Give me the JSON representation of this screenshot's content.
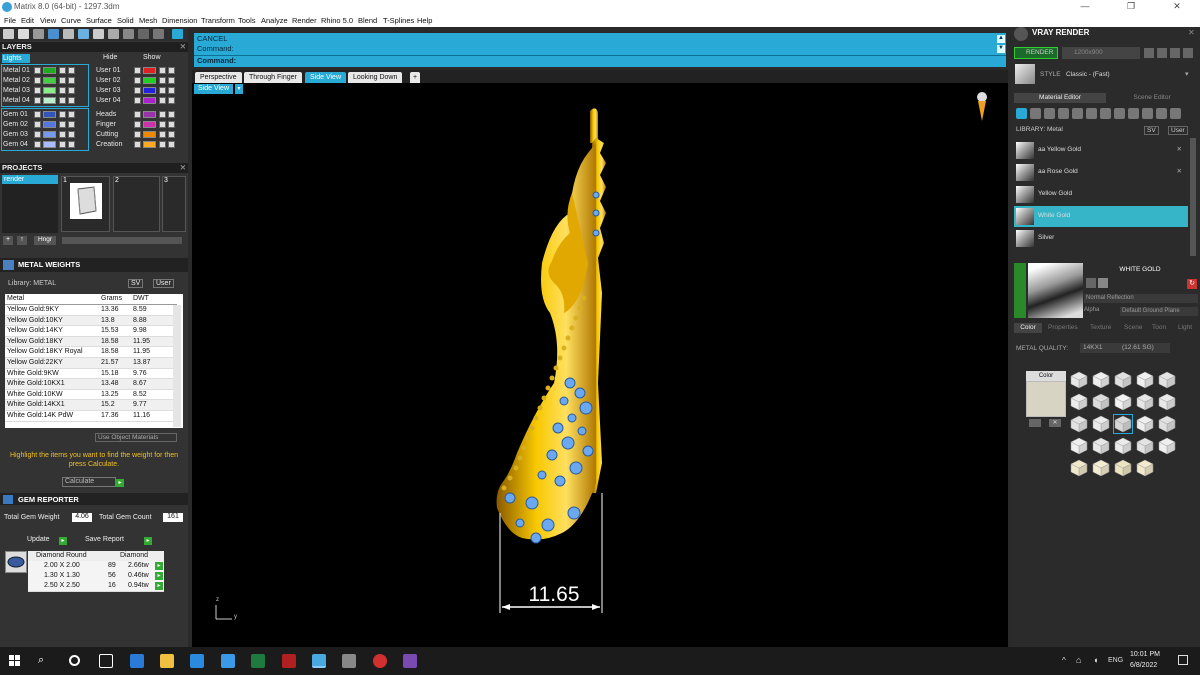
{
  "window": {
    "title": "Matrix 8.0 (64-bit) - 1297.3dm",
    "min": "—",
    "max": "❐",
    "close": "✕"
  },
  "menu": [
    "File",
    "Edit",
    "View",
    "Curve",
    "Surface",
    "Solid",
    "Mesh",
    "Dimension",
    "Transform",
    "Tools",
    "Analyze",
    "Render",
    "Rhino 5.0",
    "Blend",
    "T-Splines",
    "Help"
  ],
  "layers": {
    "title": "LAYERS",
    "lights": "Lights",
    "hide": "Hide",
    "show": "Show",
    "left": [
      {
        "name": "Metal 01",
        "color": "#22aa22"
      },
      {
        "name": "Metal 02",
        "color": "#44cc44"
      },
      {
        "name": "Metal 03",
        "color": "#88ee88"
      },
      {
        "name": "Metal 04",
        "color": "#bbeecc"
      },
      {
        "name": "Gem 01",
        "color": "#3355bb"
      },
      {
        "name": "Gem 02",
        "color": "#5577dd"
      },
      {
        "name": "Gem 03",
        "color": "#7799ee"
      },
      {
        "name": "Gem 04",
        "color": "#aabbff"
      }
    ],
    "right": [
      {
        "name": "User 01",
        "color": "#dd2222"
      },
      {
        "name": "User 02",
        "color": "#22cc22"
      },
      {
        "name": "User 03",
        "color": "#2222dd"
      },
      {
        "name": "User 04",
        "color": "#aa22cc"
      },
      {
        "name": "Heads",
        "color": "#9933aa"
      },
      {
        "name": "Finger",
        "color": "#cc33aa"
      },
      {
        "name": "Cutting",
        "color": "#ee8800"
      },
      {
        "name": "Creation",
        "color": "#ffaa22"
      }
    ]
  },
  "projects": {
    "title": "PROJECTS",
    "item": "render",
    "slots": [
      "1",
      "2",
      "3"
    ],
    "ring_btn": "Hngr"
  },
  "metal_weights": {
    "title": "METAL WEIGHTS",
    "library_label": "Library: METAL",
    "sv": "SV",
    "user": "User",
    "headers": [
      "Metal",
      "Grams",
      "DWT"
    ],
    "rows": [
      [
        "Yellow Gold:9KY",
        "13.36",
        "8.59"
      ],
      [
        "Yellow Gold:10KY",
        "13.8",
        "8.88"
      ],
      [
        "Yellow Gold:14KY",
        "15.53",
        "9.98"
      ],
      [
        "Yellow Gold:18KY",
        "18.58",
        "11.95"
      ],
      [
        "Yellow Gold:18KY Royal",
        "18.58",
        "11.95"
      ],
      [
        "Yellow Gold:22KY",
        "21.57",
        "13.87"
      ],
      [
        "White Gold:9KW",
        "15.18",
        "9.76"
      ],
      [
        "White Gold:10KX1",
        "13.48",
        "8.67"
      ],
      [
        "White Gold:10KW",
        "13.25",
        "8.52"
      ],
      [
        "White Gold:14KX1",
        "15.2",
        "9.77"
      ],
      [
        "White Gold:14K PdW",
        "17.36",
        "11.16"
      ]
    ],
    "use_object_materials": "Use Object Materials",
    "hint": "Highlight the items you want to find the weight for then press Calculate.",
    "calculate": "Calculate"
  },
  "gem_reporter": {
    "title": "GEM REPORTER",
    "total_weight_label": "Total Gem Weight",
    "total_weight": "4.06",
    "total_count_label": "Total Gem Count",
    "total_count": "161",
    "update": "Update",
    "save": "Save Report",
    "headers": [
      "Diamond Round",
      "Diamond"
    ],
    "rows": [
      [
        "2.00 X 2.00",
        "89",
        "2.66tw"
      ],
      [
        "1.30 X 1.30",
        "56",
        "0.46tw"
      ],
      [
        "2.50 X 2.50",
        "16",
        "0.94tw"
      ]
    ]
  },
  "command": {
    "line1": "CANCEL",
    "line2": "Command:",
    "line3": "Command:"
  },
  "viewport_tabs": [
    "Perspective",
    "Through Finger",
    "Side View",
    "Looking Down",
    "+"
  ],
  "active_tab": "Side View",
  "viewport": {
    "label": "Side View",
    "dimension": "11.65",
    "axis_z": "z",
    "axis_y": "y"
  },
  "vray": {
    "title": "VRAY RENDER",
    "render_btn": "RENDER",
    "resolution": "1200x900",
    "style_label": "STYLE",
    "style_value": "Classic - (Fast)",
    "tabs": [
      "Material Editor",
      "Scene Editor"
    ],
    "library_label": "LIBRARY: Metal",
    "sv": "SV",
    "user": "User",
    "materials": [
      "aa Yellow Gold",
      "aa Rose Gold",
      "Yellow Gold",
      "White Gold",
      "Silver"
    ],
    "selected_material": "White Gold",
    "preview_name": "WHITE GOLD",
    "reflection": "Normal Reflection",
    "alpha": "Alpha",
    "ground": "Default Ground Plane",
    "subtabs": [
      "Color",
      "Properties",
      "Texture",
      "Scene",
      "Toon",
      "Light"
    ],
    "metal_quality_label": "METAL QUALITY:",
    "metal_quality": "14KX1",
    "metal_quality_weight": "(12.61 SG)",
    "color_label": "Color"
  },
  "taskbar": {
    "lang": "ENG",
    "time": "10:01 PM",
    "date": "6/8/2022"
  }
}
